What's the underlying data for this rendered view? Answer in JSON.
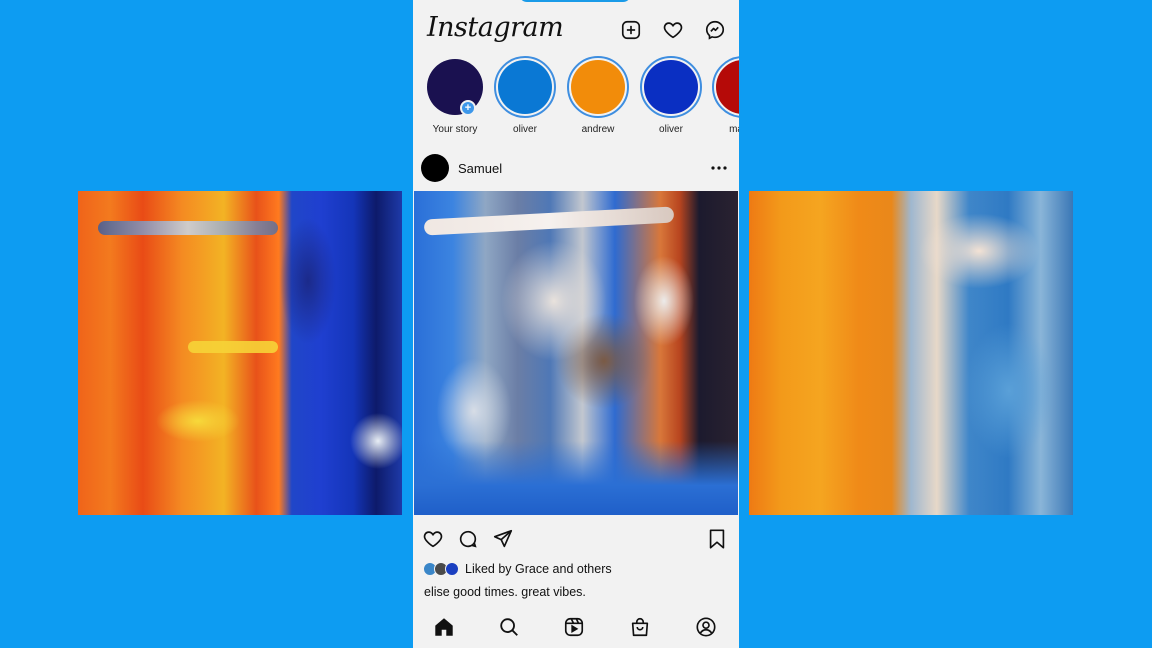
{
  "colors": {
    "background": "#0d9cf2",
    "phone_bg": "#f2f2f2",
    "story_ring": "#3e8ee0"
  },
  "app": {
    "logo": "Instagram"
  },
  "topbar": {
    "icons": [
      "new-post-icon",
      "heart-icon",
      "messenger-icon"
    ]
  },
  "stories": [
    {
      "label": "Your story",
      "color": "#1a1150",
      "own": true
    },
    {
      "label": "oliver",
      "color": "#0a78d4"
    },
    {
      "label": "andrew",
      "color": "#f28c0a"
    },
    {
      "label": "oliver",
      "color": "#0a2fc2"
    },
    {
      "label": "mateo",
      "color": "#b50a08"
    }
  ],
  "post": {
    "username": "Samuel",
    "liked_by": "Liked by Grace and others",
    "liked_avatar_colors": [
      "#3a86c8",
      "#4a4a4a",
      "#1a3fc0"
    ],
    "caption": "elise good times. great vibes."
  },
  "bottom_nav": [
    "home-icon",
    "search-icon",
    "reels-icon",
    "shop-icon",
    "profile-icon"
  ]
}
